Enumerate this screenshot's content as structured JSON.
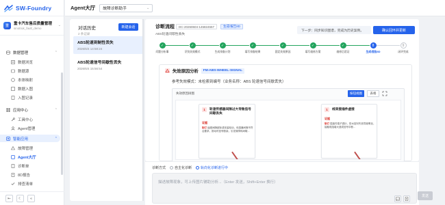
{
  "app": {
    "name": "SW-Foundry"
  },
  "project": {
    "name": "重卡汽车售后质量管理",
    "sub": "sinotruk_fault_demo",
    "avatar": "重"
  },
  "sidebar": {
    "items": [
      {
        "label": "数据管理",
        "type": "group",
        "icon": "database-icon"
      },
      {
        "label": "数据浏览",
        "type": "sub",
        "icon": "list-icon"
      },
      {
        "label": "数据源",
        "type": "sub",
        "icon": "source-icon"
      },
      {
        "label": "本体映射",
        "type": "sub",
        "icon": "ontology-icon"
      },
      {
        "label": "数据入图",
        "type": "sub",
        "icon": "graph-icon"
      },
      {
        "label": "入图记录",
        "type": "sub",
        "icon": "record-icon"
      },
      {
        "label": "应用中心",
        "type": "group",
        "icon": "app-icon"
      },
      {
        "label": "工具中心",
        "type": "sub",
        "icon": "tool-icon"
      },
      {
        "label": "Agent管理",
        "type": "sub",
        "icon": "agent-icon"
      },
      {
        "label": "智能应用",
        "type": "group-active",
        "icon": "smart-icon"
      },
      {
        "label": "故障管理",
        "type": "sub",
        "icon": "fault-icon"
      },
      {
        "label": "Agent大厅",
        "type": "sub-active",
        "icon": "hall-icon"
      },
      {
        "label": "诊断单",
        "type": "sub",
        "icon": "ticket-icon"
      },
      {
        "label": "8D报告",
        "type": "sub",
        "icon": "report-icon"
      },
      {
        "label": "排查清单",
        "type": "sub",
        "icon": "checklist-icon"
      }
    ],
    "footer": [
      "⇤",
      "☾",
      "«"
    ]
  },
  "topbar": {
    "title": "Agent大厅",
    "select_value": "故障诊断助手"
  },
  "history": {
    "title": "对话历史",
    "count": "2 条记录",
    "new_label": "新建会话",
    "items": [
      {
        "title": "ABS轮速到制性丢失",
        "date": "2026/6/4 14:58:24"
      },
      {
        "title": "ABS轮速信号间歇性丢失",
        "date": "2026/6/4 15:56:54"
      }
    ]
  },
  "flow": {
    "title": "诊断流程",
    "id": "DC-20260604-145824557",
    "status": "生成/报告8D",
    "subtitle": "ABS轮速间歇性丢失",
    "next_step": "下一步：同步知识图谱，完成为历史案例。",
    "confirm_label": "确认回环并更新",
    "steps": [
      {
        "label": "问题分析事",
        "state": "done"
      },
      {
        "label": "识别失效模式",
        "state": "done"
      },
      {
        "label": "生成排查计划",
        "state": "done"
      },
      {
        "label": "填写排查结果",
        "state": "done"
      },
      {
        "label": "固定失效原因",
        "state": "done"
      },
      {
        "label": "填写维修方案",
        "state": "done"
      },
      {
        "label": "维修后验证",
        "state": "done"
      },
      {
        "label": "生成/报告8D",
        "state": "current",
        "num": "8"
      },
      {
        "label": "闭环完成",
        "state": "todo",
        "num": "9"
      }
    ]
  },
  "analysis": {
    "title": "失效原因分析",
    "badge": "FM-ABS-WHEEL-SIGNAL",
    "ref_mode": "参考失效模式：未检索到编号（业务名称：ABS 轮速信号间歇丢失）",
    "tree_title": "失效原因树图",
    "btn_primary": "按钮视图",
    "btn_secondary": "表格",
    "cards": [
      {
        "num": "1",
        "title": "轮速传感器间隙过大导致信号间歇丢失",
        "evidence": "证据",
        "body_tag": "制订",
        "body": "齿圈间隙超标或安装松动，传感器间隙不符合要求，振动时信号断续，引发故障码间歇..."
      },
      {
        "num": "1",
        "title": "线束接插件虚接",
        "evidence": "证据",
        "body_tag": "制订",
        "body": "插接件端子退针，防水密封失效导致氧化，接触电阻增大造成信号中断..."
      }
    ]
  },
  "input": {
    "mode_label": "诊断方式",
    "modes": [
      {
        "label": "自主化诊断",
        "selected": false
      },
      {
        "label": "轨向化诊断进行中",
        "selected": true
      }
    ],
    "placeholder": "描述故障现象，可上传图片辅助分析...（Enter 发送，Shift+Enter 换行）",
    "send_label": "发送"
  },
  "colors": {
    "primary": "#2563eb",
    "success": "#22a45d",
    "danger": "#d9342b"
  }
}
